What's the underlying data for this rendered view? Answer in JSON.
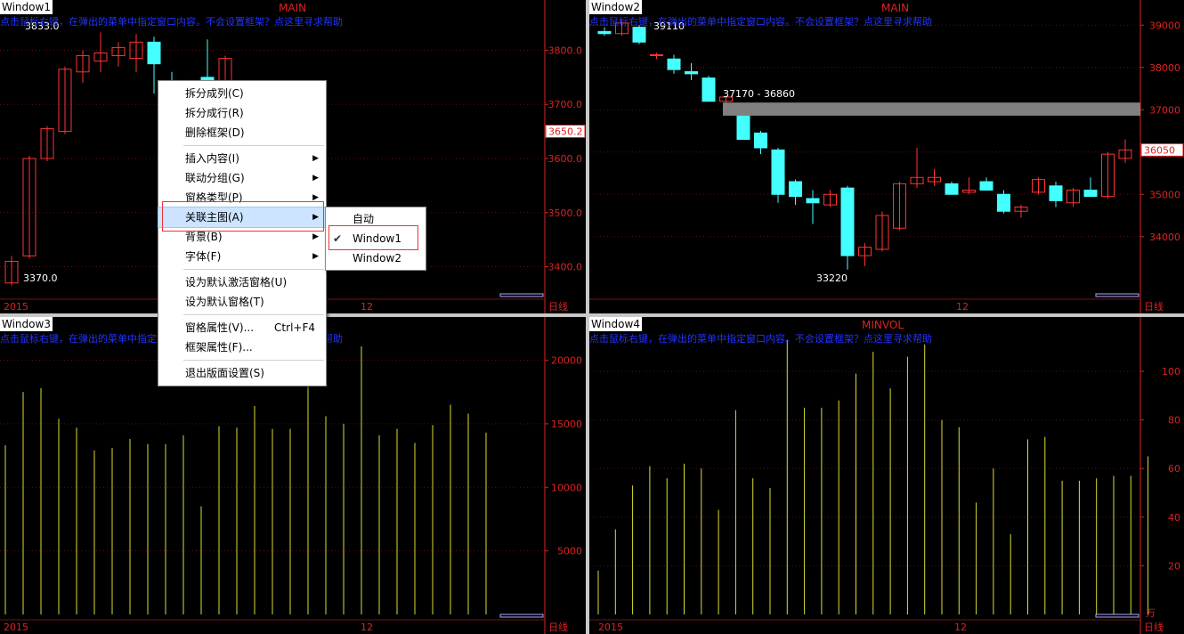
{
  "colors": {
    "up": "#ff3333",
    "down": "#44ffff",
    "volume": "#dddd33",
    "axis": "#dd2222",
    "hint": "#2233ff"
  },
  "windows": [
    {
      "title": "Window1",
      "type": "MAIN",
      "hint": "点击鼠标右键，在弹出的菜单中指定窗口内容。不会设置框架？点这里寻求帮助",
      "y_ticks": [
        "3800.0",
        "3700.0",
        "3600.0",
        "3500.0",
        "3400.0"
      ],
      "x_labels": [
        "2015",
        "12"
      ],
      "period": "日线",
      "high_label": "3833.0",
      "low_label": "3370.0",
      "last_price": "3650.2",
      "chart_data": {
        "type": "candlestick",
        "ylim": [
          3340,
          3860
        ],
        "candles": [
          {
            "o": 3370,
            "h": 3420,
            "l": 3365,
            "c": 3410
          },
          {
            "o": 3420,
            "h": 3605,
            "l": 3415,
            "c": 3600
          },
          {
            "o": 3600,
            "h": 3660,
            "l": 3595,
            "c": 3655
          },
          {
            "o": 3650,
            "h": 3770,
            "l": 3645,
            "c": 3765
          },
          {
            "o": 3760,
            "h": 3800,
            "l": 3740,
            "c": 3790
          },
          {
            "o": 3780,
            "h": 3833,
            "l": 3760,
            "c": 3795
          },
          {
            "o": 3790,
            "h": 3815,
            "l": 3770,
            "c": 3805
          },
          {
            "o": 3785,
            "h": 3830,
            "l": 3760,
            "c": 3815
          },
          {
            "o": 3815,
            "h": 3825,
            "l": 3720,
            "c": 3775
          },
          {
            "o": 3730,
            "h": 3760,
            "l": 3710,
            "c": 3725
          },
          {
            "o": 3725,
            "h": 3745,
            "l": 3700,
            "c": 3735
          },
          {
            "o": 3750,
            "h": 3820,
            "l": 3730,
            "c": 3720
          },
          {
            "o": 3730,
            "h": 3790,
            "l": 3720,
            "c": 3785
          }
        ]
      }
    },
    {
      "title": "Window2",
      "type": "MAIN",
      "hint": "点击鼠标右键，在弹出的菜单中指定窗口内容。不会设置框架？点这里寻求帮助",
      "y_ticks": [
        "39000",
        "38000",
        "37000",
        "36000",
        "35000",
        "34000"
      ],
      "x_labels": [
        "12"
      ],
      "period": "日线",
      "high_label": "39110",
      "low_label": "33220",
      "last_price": "36050",
      "gap_label": "37170 - 36860",
      "chart_data": {
        "type": "candlestick",
        "ylim": [
          32900,
          39300
        ],
        "candles": [
          {
            "o": 38850,
            "h": 38950,
            "l": 38750,
            "c": 38800
          },
          {
            "o": 38800,
            "h": 39110,
            "l": 38750,
            "c": 39050
          },
          {
            "o": 38950,
            "h": 39000,
            "l": 38550,
            "c": 38600
          },
          {
            "o": 38300,
            "h": 38350,
            "l": 38200,
            "c": 38300
          },
          {
            "o": 38200,
            "h": 38300,
            "l": 37850,
            "c": 37950
          },
          {
            "o": 37900,
            "h": 38100,
            "l": 37700,
            "c": 37850
          },
          {
            "o": 37750,
            "h": 37800,
            "l": 37200,
            "c": 37200
          },
          {
            "o": 37200,
            "h": 37300,
            "l": 37150,
            "c": 37300
          },
          {
            "o": 36860,
            "h": 36900,
            "l": 36300,
            "c": 36300
          },
          {
            "o": 36450,
            "h": 36500,
            "l": 35950,
            "c": 36100
          },
          {
            "o": 36050,
            "h": 36100,
            "l": 34800,
            "c": 35000
          },
          {
            "o": 35300,
            "h": 35350,
            "l": 34750,
            "c": 34950
          },
          {
            "o": 34900,
            "h": 35100,
            "l": 34300,
            "c": 34800
          },
          {
            "o": 34750,
            "h": 35100,
            "l": 34700,
            "c": 35000
          },
          {
            "o": 35150,
            "h": 35200,
            "l": 33220,
            "c": 33550
          },
          {
            "o": 33550,
            "h": 33850,
            "l": 33300,
            "c": 33750
          },
          {
            "o": 33700,
            "h": 34600,
            "l": 33650,
            "c": 34500
          },
          {
            "o": 34200,
            "h": 35300,
            "l": 34150,
            "c": 35250
          },
          {
            "o": 35250,
            "h": 36100,
            "l": 35150,
            "c": 35400
          },
          {
            "o": 35300,
            "h": 35600,
            "l": 35200,
            "c": 35400
          },
          {
            "o": 35250,
            "h": 35300,
            "l": 35050,
            "c": 35000
          },
          {
            "o": 35050,
            "h": 35400,
            "l": 35000,
            "c": 35100
          },
          {
            "o": 35300,
            "h": 35400,
            "l": 35100,
            "c": 35100
          },
          {
            "o": 35000,
            "h": 35100,
            "l": 34550,
            "c": 34600
          },
          {
            "o": 34600,
            "h": 34750,
            "l": 34450,
            "c": 34700
          },
          {
            "o": 35050,
            "h": 35400,
            "l": 35000,
            "c": 35350
          },
          {
            "o": 35200,
            "h": 35300,
            "l": 34700,
            "c": 34850
          },
          {
            "o": 34800,
            "h": 35150,
            "l": 34700,
            "c": 35100
          },
          {
            "o": 35100,
            "h": 35400,
            "l": 34950,
            "c": 34950
          },
          {
            "o": 34950,
            "h": 36000,
            "l": 34900,
            "c": 35950
          },
          {
            "o": 35850,
            "h": 36300,
            "l": 35750,
            "c": 36050
          }
        ]
      }
    },
    {
      "title": "Window3",
      "type": "",
      "hint": "点击鼠标右键，在弹出的菜单中指定窗口内容。不会设置框架？点这里寻求帮助",
      "y_ticks": [
        "20000",
        "15000",
        "10000",
        "5000"
      ],
      "x_labels": [
        "2015",
        "12"
      ],
      "period": "日线",
      "chart_data": {
        "type": "bar",
        "ylim": [
          0,
          22000
        ],
        "values": [
          13300,
          17500,
          17800,
          15400,
          14700,
          12900,
          13100,
          13800,
          13400,
          13400,
          14100,
          8500,
          14800,
          14700,
          16400,
          14600,
          14600,
          18100,
          15600,
          15000,
          21100,
          14100,
          14600,
          13500,
          14900,
          16500,
          15800,
          14300
        ]
      }
    },
    {
      "title": "Window4",
      "type": "MINVOL",
      "hint": "点击鼠标右键，在弹出的菜单中指定窗口内容。不会设置框架？点这里寻求帮助",
      "y_ticks": [
        "100",
        "80",
        "60",
        "40",
        "20"
      ],
      "x_labels": [
        "2015",
        "12"
      ],
      "period": "日线",
      "unit": "万",
      "chart_data": {
        "type": "bar",
        "ylim": [
          0,
          115
        ],
        "values": [
          18,
          35,
          53,
          61,
          56,
          62,
          60,
          43,
          84,
          56,
          52,
          113,
          85,
          85,
          88,
          99,
          108,
          93,
          106,
          111,
          80,
          77,
          46,
          60,
          33,
          72,
          73,
          55,
          55,
          56,
          57,
          57,
          65
        ]
      }
    }
  ],
  "context_menu": {
    "items": [
      {
        "label": "拆分成列(C)",
        "submenu": false
      },
      {
        "label": "拆分成行(R)",
        "submenu": false
      },
      {
        "label": "删除框架(D)",
        "submenu": false
      },
      {
        "sep": true
      },
      {
        "label": "插入内容(I)",
        "submenu": true
      },
      {
        "label": "联动分组(G)",
        "submenu": true
      },
      {
        "label": "窗格类型(P)",
        "submenu": true
      },
      {
        "label": "关联主图(A)",
        "submenu": true,
        "highlight": true
      },
      {
        "label": "背景(B)",
        "submenu": true
      },
      {
        "label": "字体(F)",
        "submenu": true
      },
      {
        "sep": true
      },
      {
        "label": "设为默认激活窗格(U)",
        "submenu": false
      },
      {
        "label": "设为默认窗格(T)",
        "submenu": false
      },
      {
        "sep": true
      },
      {
        "label": "窗格属性(V)...",
        "shortcut": "Ctrl+F4",
        "submenu": false
      },
      {
        "label": "框架属性(F)...",
        "submenu": false
      },
      {
        "sep": true
      },
      {
        "label": "退出版面设置(S)",
        "submenu": false
      }
    ],
    "submenu": {
      "items": [
        {
          "label": "自动",
          "checked": false
        },
        {
          "label": "Window1",
          "checked": true
        },
        {
          "label": "Window2",
          "checked": false
        }
      ]
    }
  }
}
